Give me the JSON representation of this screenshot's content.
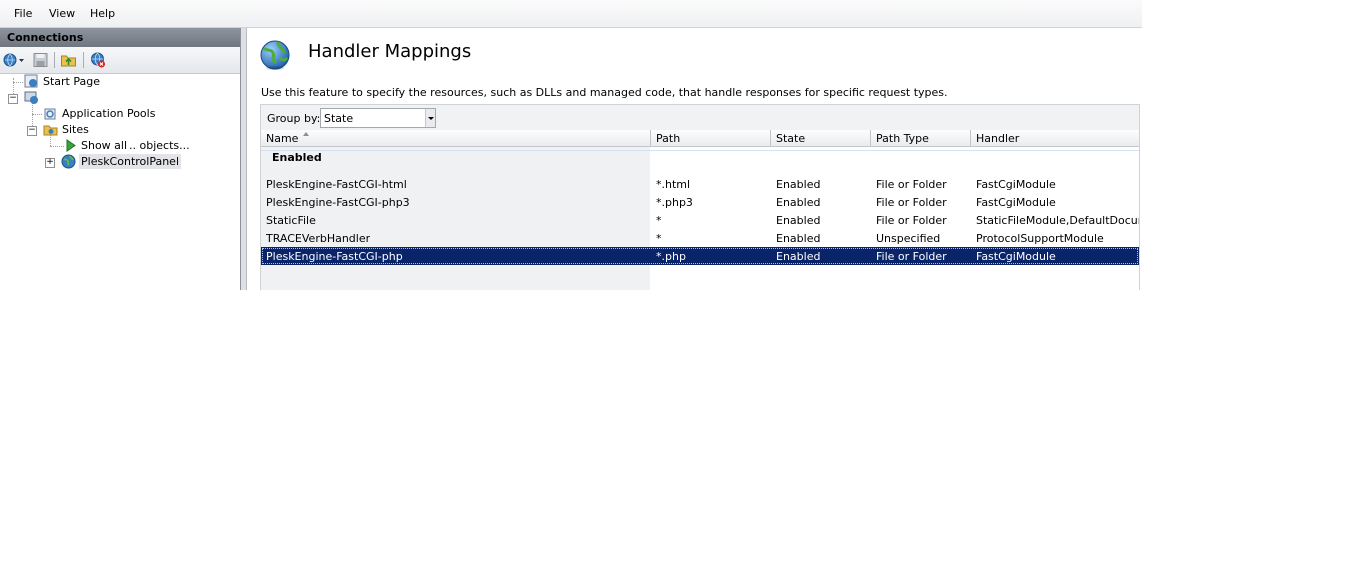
{
  "menu": {
    "items": [
      "File",
      "View",
      "Help"
    ]
  },
  "connections": {
    "title": "Connections",
    "tree": {
      "start_page": "Start Page",
      "server_node": "",
      "app_pools": "Application Pools",
      "sites": "Sites",
      "show_all": "Show all",
      "objects": ".. objects...",
      "plesk_site": "PleskControlPanel"
    }
  },
  "feature": {
    "title": "Handler Mappings",
    "description": "Use this feature to specify the resources, such as DLLs and managed code, that handle responses for specific request types.",
    "group_by_label": "Group by:",
    "group_by_value": "State"
  },
  "grid": {
    "columns": [
      "Name",
      "Path",
      "State",
      "Path Type",
      "Handler"
    ],
    "group_label": "Enabled",
    "rows": [
      {
        "name": "PleskEngine-FastCGI-html",
        "path": "*.html",
        "state": "Enabled",
        "path_type": "File or Folder",
        "handler": "FastCgiModule"
      },
      {
        "name": "PleskEngine-FastCGI-php3",
        "path": "*.php3",
        "state": "Enabled",
        "path_type": "File or Folder",
        "handler": "FastCgiModule"
      },
      {
        "name": "StaticFile",
        "path": "*",
        "state": "Enabled",
        "path_type": "File or Folder",
        "handler": "StaticFileModule,DefaultDocume..."
      },
      {
        "name": "TRACEVerbHandler",
        "path": "*",
        "state": "Enabled",
        "path_type": "Unspecified",
        "handler": "ProtocolSupportModule"
      },
      {
        "name": "PleskEngine-FastCGI-php",
        "path": "*.php",
        "state": "Enabled",
        "path_type": "File or Folder",
        "handler": "FastCgiModule"
      }
    ],
    "selected_row": 4
  },
  "colors": {
    "selection": "#0a246a",
    "header_dark": "#7a818a",
    "name_column_bg": "#f0f1f3"
  },
  "icons": {
    "toolbar": [
      "connect-globe-icon",
      "save-icon",
      "up-folder-icon",
      "disconnect-icon"
    ],
    "tree": [
      "start-page-icon",
      "server-icon",
      "app-pools-icon",
      "sites-folder-icon",
      "play-icon",
      "globe-icon"
    ]
  }
}
